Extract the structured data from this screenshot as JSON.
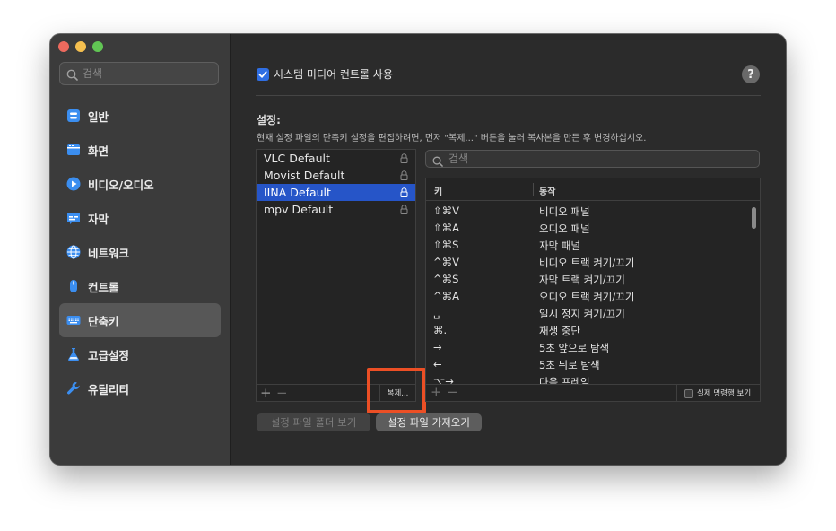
{
  "sidebar": {
    "search_placeholder": "검색",
    "items": [
      {
        "label": "일반",
        "icon": "general-icon"
      },
      {
        "label": "화면",
        "icon": "display-icon"
      },
      {
        "label": "비디오/오디오",
        "icon": "play-icon"
      },
      {
        "label": "자막",
        "icon": "subtitle-icon"
      },
      {
        "label": "네트워크",
        "icon": "globe-icon"
      },
      {
        "label": "컨트롤",
        "icon": "mouse-icon"
      },
      {
        "label": "단축키",
        "icon": "keyboard-icon",
        "selected": true
      },
      {
        "label": "고급설정",
        "icon": "flask-icon"
      },
      {
        "label": "유틸리티",
        "icon": "wrench-icon"
      }
    ]
  },
  "main": {
    "media_control_label": "시스템 미디어 컨트롤 사용",
    "media_control_checked": true,
    "help_label": "?",
    "section_title": "설정:",
    "section_desc": "현재 설정 파일의 단축키 설정을 편집하려면, 먼저 \"복제...\" 버튼을 눌러 복사본을 만든 후 변경하십시오.",
    "profiles": [
      {
        "name": "VLC Default",
        "locked": true
      },
      {
        "name": "Movist Default",
        "locked": true
      },
      {
        "name": "IINA Default",
        "locked": true,
        "selected": true
      },
      {
        "name": "mpv Default",
        "locked": true
      }
    ],
    "profile_add": "+",
    "profile_remove": "−",
    "duplicate_label": "복제...",
    "search_placeholder": "검색",
    "table": {
      "columns": [
        "키",
        "동작"
      ],
      "rows": [
        {
          "key": "⇧⌘V",
          "action": "비디오 패널"
        },
        {
          "key": "⇧⌘A",
          "action": "오디오 패널"
        },
        {
          "key": "⇧⌘S",
          "action": "자막 패널"
        },
        {
          "key": "^⌘V",
          "action": " 비디오 트랙 켜기/끄기"
        },
        {
          "key": "^⌘S",
          "action": " 자막 트랙 켜기/끄기"
        },
        {
          "key": "^⌘A",
          "action": " 오디오 트랙 켜기/끄기"
        },
        {
          "key": "␣",
          "action": " 일시 정지 켜기/끄기"
        },
        {
          "key": "⌘.",
          "action": "재생 중단"
        },
        {
          "key": "→",
          "action": " 5초  앞으로 탐색"
        },
        {
          "key": "←",
          "action": " 5초  뒤로 탐색"
        },
        {
          "key": "⌥→",
          "action": "다음 프레임"
        }
      ]
    },
    "table_add": "+",
    "table_remove": "−",
    "raw_command_label": "실제 명령행 보기",
    "raw_command_checked": false,
    "open_folder_label": "설정 파일 폴더 보기",
    "import_label": "설정 파일 가져오기"
  },
  "colors": {
    "accent": "#2f6ee3",
    "selection": "#2655c8",
    "highlight": "#ec4f25"
  }
}
